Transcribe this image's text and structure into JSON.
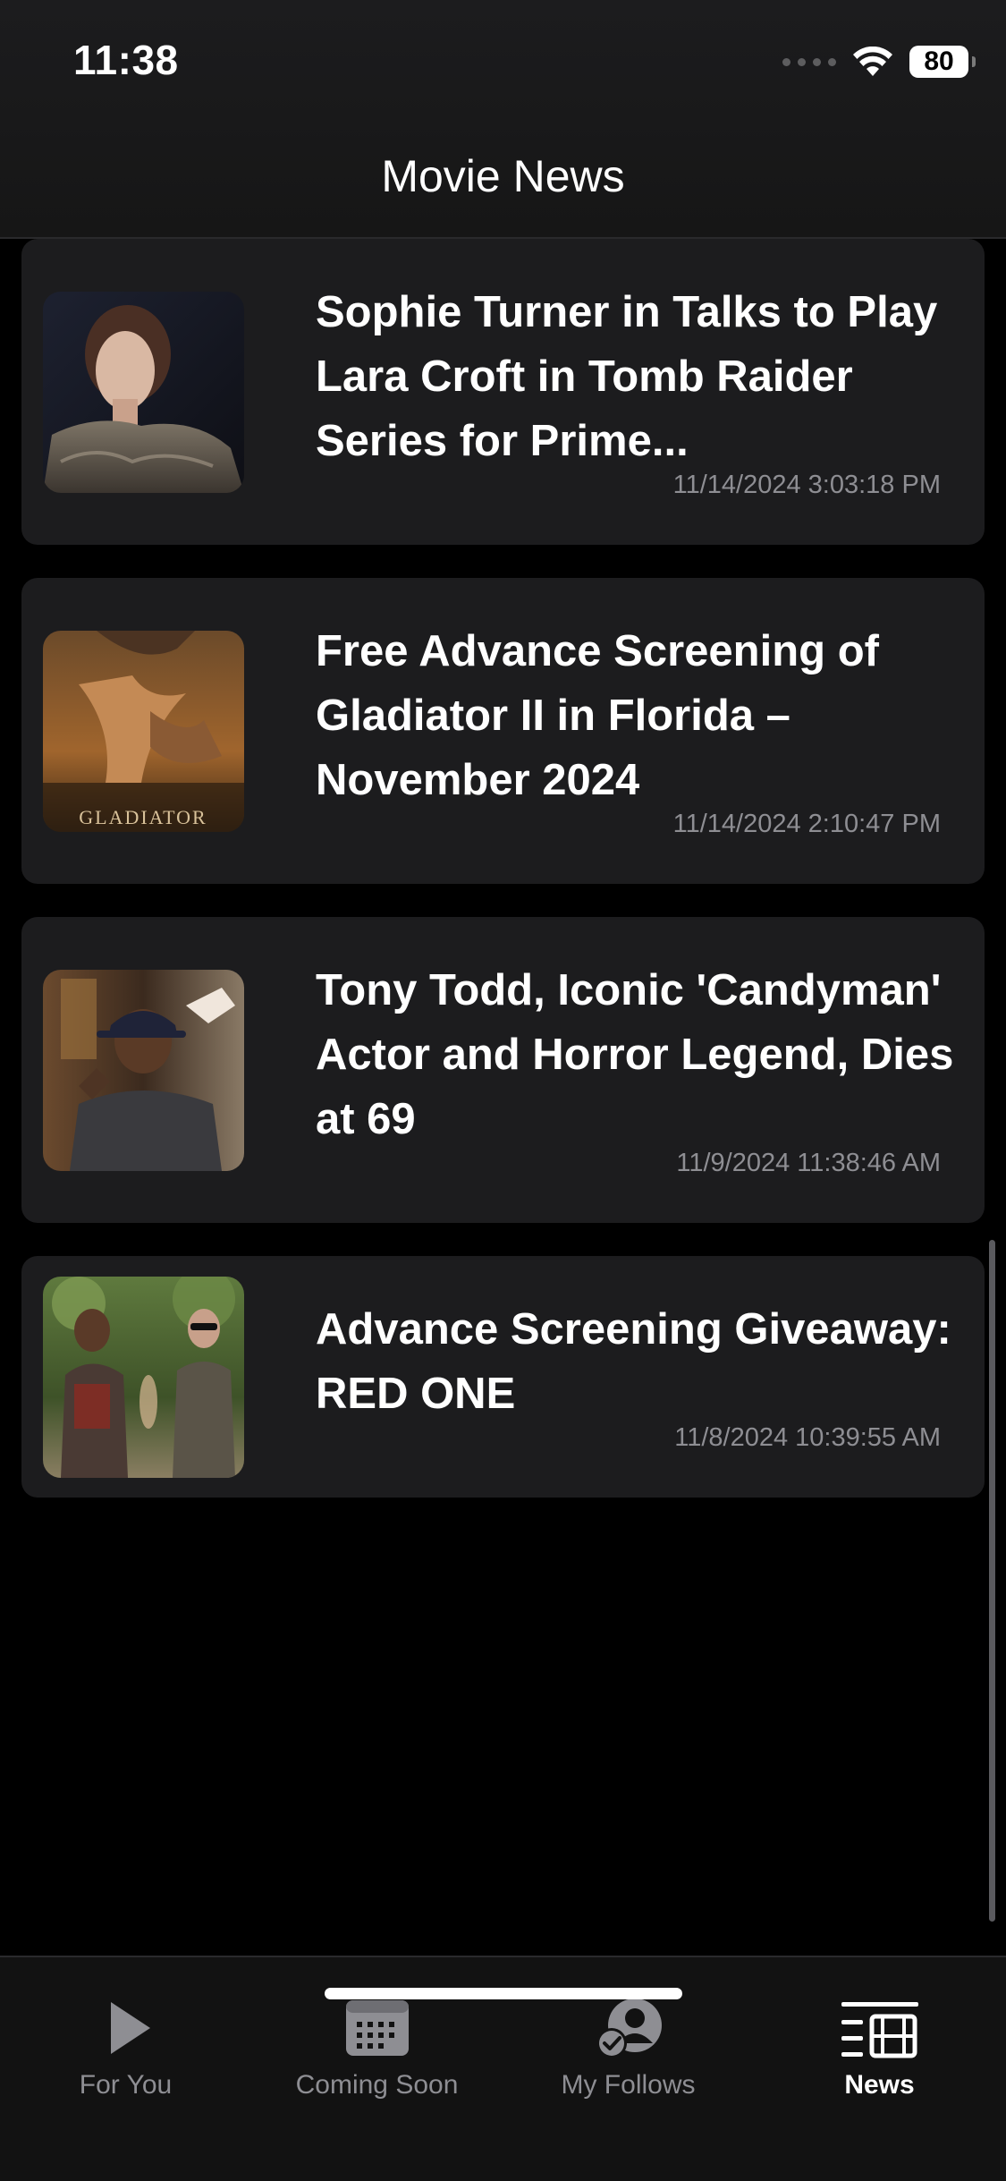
{
  "status_bar": {
    "time": "11:38",
    "battery": "80"
  },
  "nav": {
    "title": "Movie News"
  },
  "news": [
    {
      "title": "Sophie Turner in Talks to Play Lara Croft in Tomb Raider Series for Prime...",
      "date": "11/14/2024 3:03:18 PM",
      "thumb_icon": "portrait-woman-fur-image"
    },
    {
      "title": "Free Advance Screening of Gladiator II in Florida – November 2024",
      "date": "11/14/2024 2:10:47 PM",
      "thumb_icon": "gladiator-poster-image",
      "thumb_text": "GLADIATOR"
    },
    {
      "title": "Tony Todd, Iconic 'Candyman' Actor and Horror Legend, Dies at 69",
      "date": "11/9/2024 11:38:46 AM",
      "thumb_icon": "man-cap-image"
    },
    {
      "title": "Advance Screening Giveaway: RED ONE",
      "date": "11/8/2024 10:39:55 AM",
      "thumb_icon": "red-one-scene-image"
    }
  ],
  "tabs": [
    {
      "label": "For You",
      "icon": "play-icon",
      "active": false
    },
    {
      "label": "Coming Soon",
      "icon": "calendar-icon",
      "active": false
    },
    {
      "label": "My Follows",
      "icon": "follows-icon",
      "active": false
    },
    {
      "label": "News",
      "icon": "news-icon",
      "active": true
    }
  ],
  "colors": {
    "background": "#000000",
    "card": "#1c1c1e",
    "secondary_text": "#8e8e93",
    "active_tab": "#ffffff"
  }
}
